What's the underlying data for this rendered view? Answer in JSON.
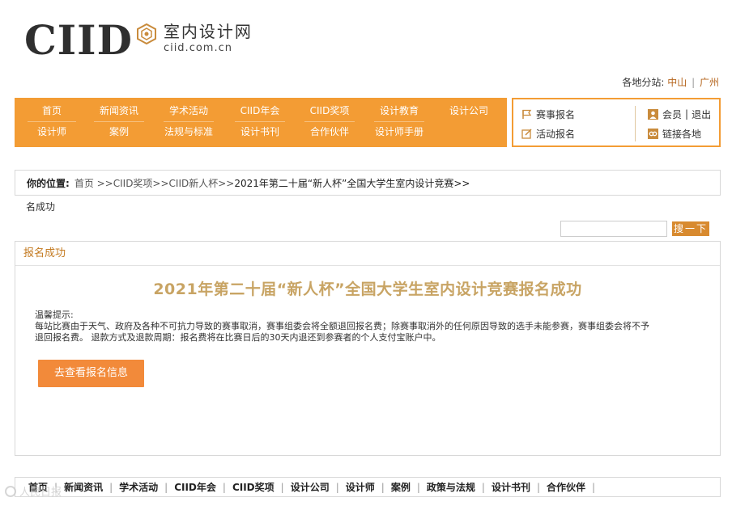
{
  "logo": {
    "brand": "CIID",
    "cn_name": "室内设计网",
    "url": "ciid.com.cn"
  },
  "branches": {
    "label": "各地分站:",
    "items": [
      "中山",
      "广州"
    ],
    "sep": "|"
  },
  "nav": {
    "row1": [
      "首页",
      "新闻资讯",
      "学术活动",
      "CIID年会",
      "CIID奖项",
      "设计教育",
      "设计公司"
    ],
    "row2": [
      "设计师",
      "案例",
      "法规与标准",
      "设计书刊",
      "合作伙伴",
      "设计师手册"
    ]
  },
  "member_box": {
    "competition_signup": "赛事报名",
    "activity_signup": "活动报名",
    "member": "会员",
    "logout": "退出",
    "links": "链接各地"
  },
  "breadcrumb": {
    "label": "你的位置:",
    "path": "首页 >>CIID奖项>>CIID新人杯>>",
    "current": "2021年第二十届“新人杯”全国大学生室内设计竞赛>>",
    "wrap": "名成功"
  },
  "search": {
    "button": "搜一下",
    "placeholder": ""
  },
  "panel": {
    "heading": "报名成功",
    "title": "2021年第二十届“新人杯”全国大学生室内设计竞赛报名成功",
    "tips_label": "温馨提示:",
    "tips_line1": "每站比赛由于天气、政府及各种不可抗力导致的赛事取消，赛事组委会将全额退回报名费；除赛事取消外的任何原因导致的选手未能参赛，赛事组委会将不予",
    "tips_line2": "退回报名费。 退款方式及退款周期：报名费将在比赛日后的30天内退还到参赛者的个人支付宝账户中。",
    "cta": "去查看报名信息"
  },
  "footer_nav": [
    "首页",
    "新闻资讯",
    "学术活动",
    "CIID年会",
    "CIID奖项",
    "设计公司",
    "设计师",
    "案例",
    "政策与法规",
    "设计书刊",
    "合作伙伴"
  ],
  "watermark": "人民日报",
  "colors": {
    "accent": "#f39c34",
    "cta": "#f28a3a",
    "title": "#c8a464",
    "link": "#b5651d"
  }
}
